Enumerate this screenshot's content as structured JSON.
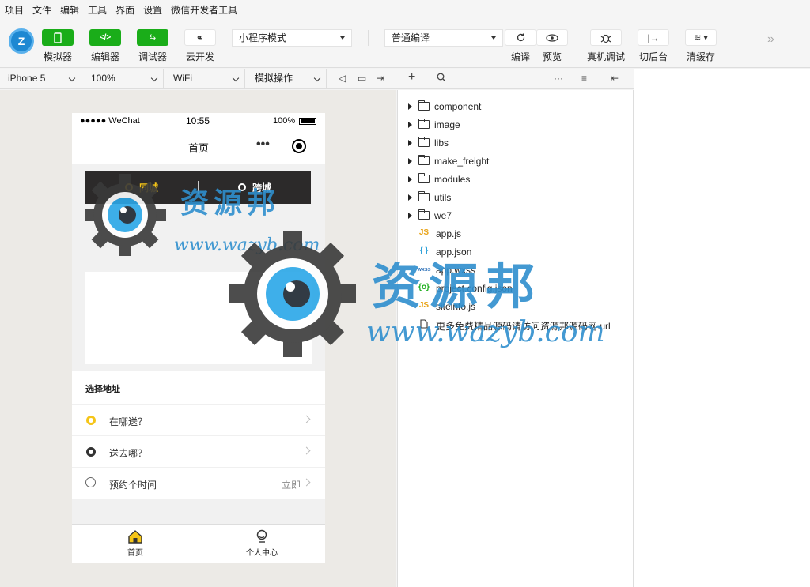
{
  "menu": [
    "项目",
    "文件",
    "编辑",
    "工具",
    "界面",
    "设置",
    "微信开发者工具"
  ],
  "toolbar": {
    "logo_text": "Z",
    "buttons": [
      {
        "label": "模拟器",
        "icon": "phone-icon"
      },
      {
        "label": "编辑器",
        "icon": "code-icon"
      },
      {
        "label": "调试器",
        "icon": "debug-arrows-icon"
      },
      {
        "label": "云开发",
        "icon": "cloud-link-icon"
      }
    ],
    "mode_select": "小程序模式",
    "compile_select": "普通编译",
    "actions": [
      {
        "label": "编译",
        "icon": "refresh-icon"
      },
      {
        "label": "预览",
        "icon": "eye-icon"
      },
      {
        "label": "真机调试",
        "icon": "bug-icon"
      },
      {
        "label": "切后台",
        "icon": "switch-icon"
      },
      {
        "label": "清缓存",
        "icon": "layers-icon"
      }
    ]
  },
  "subbar": {
    "device": "iPhone 5",
    "zoom": "100%",
    "network": "WiFi",
    "operation": "模拟操作"
  },
  "phone": {
    "status_carrier": "●●●●● WeChat",
    "status_time": "10:55",
    "status_battery": "100%",
    "nav_title": "首页",
    "tab_same_city": "同城",
    "tab_cross_city": "跨城",
    "addr_header": "选择地址",
    "addr_from": "在哪送？",
    "addr_to": "送去哪？",
    "addr_time": "预约个时间",
    "addr_time_value": "立即",
    "tab_home": "首页",
    "tab_profile": "个人中心",
    "accent_color": "#f5c518"
  },
  "files": {
    "folders": [
      "component",
      "image",
      "libs",
      "make_freight",
      "modules",
      "utils",
      "we7"
    ],
    "files": [
      {
        "icon": "JS",
        "name": "app.js"
      },
      {
        "icon": "{ }",
        "name": "app.json"
      },
      {
        "icon": "wxss",
        "name": "app.wxss"
      },
      {
        "icon": "{o}",
        "name": "project.config.json"
      },
      {
        "icon": "JS",
        "name": "siteinfo.js"
      },
      {
        "icon": "",
        "name": "更多免费精品源码请访问资源邦源码网.url"
      }
    ]
  },
  "watermark": {
    "text": "资源邦",
    "url": "www.wazyb.com"
  }
}
